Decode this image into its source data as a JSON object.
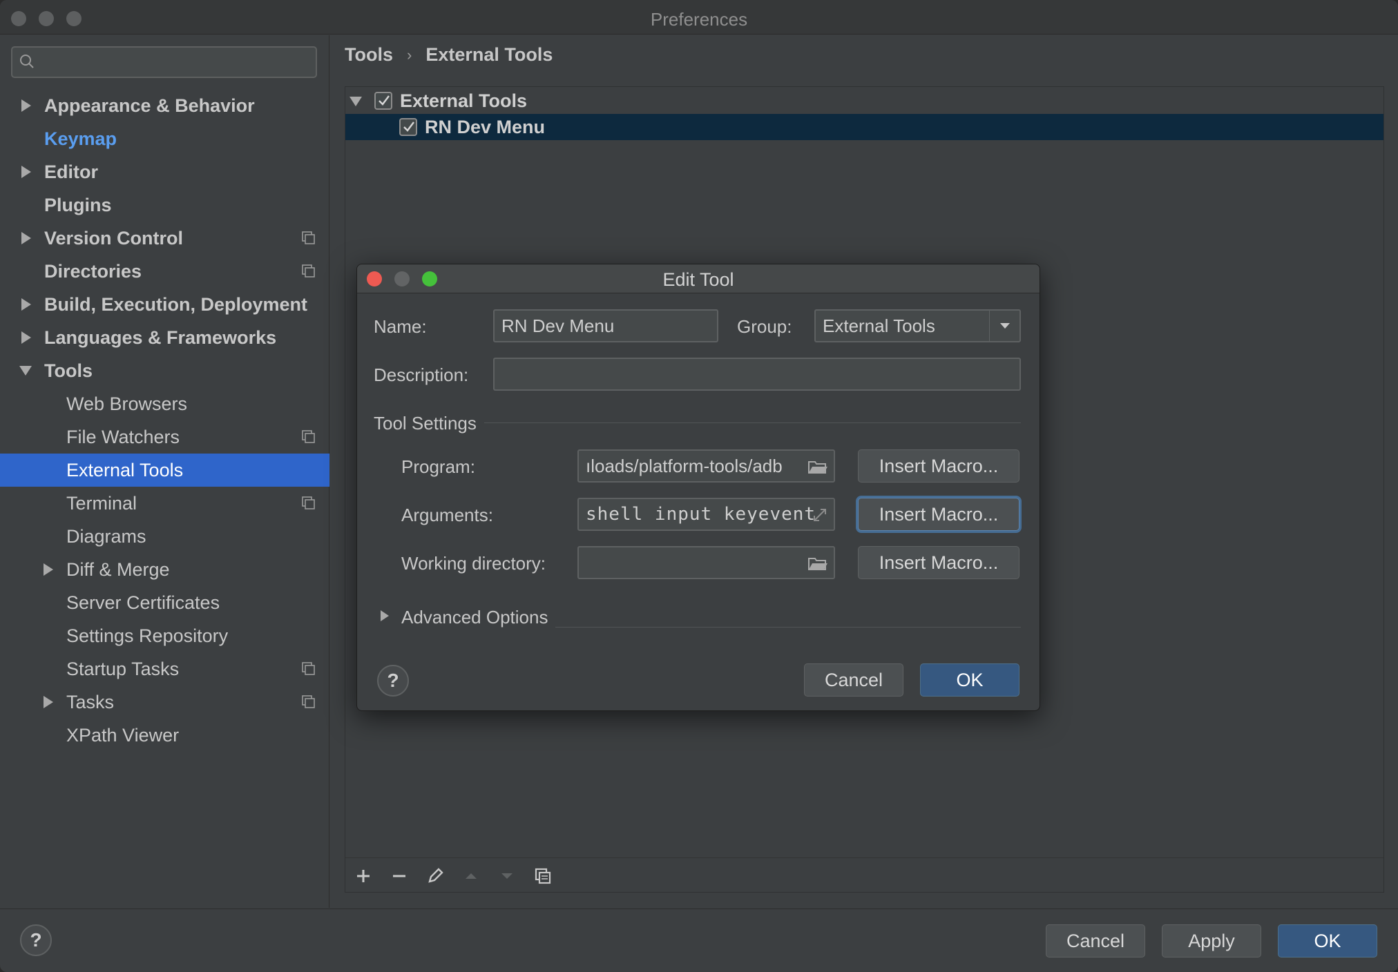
{
  "window": {
    "title": "Preferences"
  },
  "sidebar": {
    "search_placeholder": "",
    "items": [
      {
        "label": "Appearance & Behavior"
      },
      {
        "label": "Keymap"
      },
      {
        "label": "Editor"
      },
      {
        "label": "Plugins"
      },
      {
        "label": "Version Control"
      },
      {
        "label": "Directories"
      },
      {
        "label": "Build, Execution, Deployment"
      },
      {
        "label": "Languages & Frameworks"
      },
      {
        "label": "Tools"
      },
      {
        "label": "Web Browsers"
      },
      {
        "label": "File Watchers"
      },
      {
        "label": "External Tools"
      },
      {
        "label": "Terminal"
      },
      {
        "label": "Diagrams"
      },
      {
        "label": "Diff & Merge"
      },
      {
        "label": "Server Certificates"
      },
      {
        "label": "Settings Repository"
      },
      {
        "label": "Startup Tasks"
      },
      {
        "label": "Tasks"
      },
      {
        "label": "XPath Viewer"
      }
    ]
  },
  "breadcrumb": {
    "parent": "Tools",
    "separator": "›",
    "current": "External Tools"
  },
  "tree": {
    "group_label": "External Tools",
    "tool_label": "RN Dev Menu"
  },
  "dialog": {
    "title": "Edit Tool",
    "name_label": "Name:",
    "name_value": "RN Dev Menu",
    "group_label": "Group:",
    "group_value": "External Tools",
    "description_label": "Description:",
    "description_value": "",
    "tool_settings_label": "Tool Settings",
    "program_label": "Program:",
    "program_value": "ıloads/platform-tools/adb",
    "arguments_label": "Arguments:",
    "arguments_value": "shell input keyevent",
    "working_dir_label": "Working directory:",
    "working_dir_value": "",
    "insert_macro_label": "Insert Macro...",
    "advanced_options_label": "Advanced Options",
    "help_label": "?",
    "cancel_label": "Cancel",
    "ok_label": "OK"
  },
  "footer": {
    "help_label": "?",
    "cancel_label": "Cancel",
    "apply_label": "Apply",
    "ok_label": "OK"
  },
  "colors": {
    "selection": "#2f65ca",
    "link": "#5a9ef0",
    "primary_button": "#365880",
    "traffic_red": "#ee5a52",
    "traffic_yellow": "#626465",
    "traffic_green": "#45c13b"
  }
}
